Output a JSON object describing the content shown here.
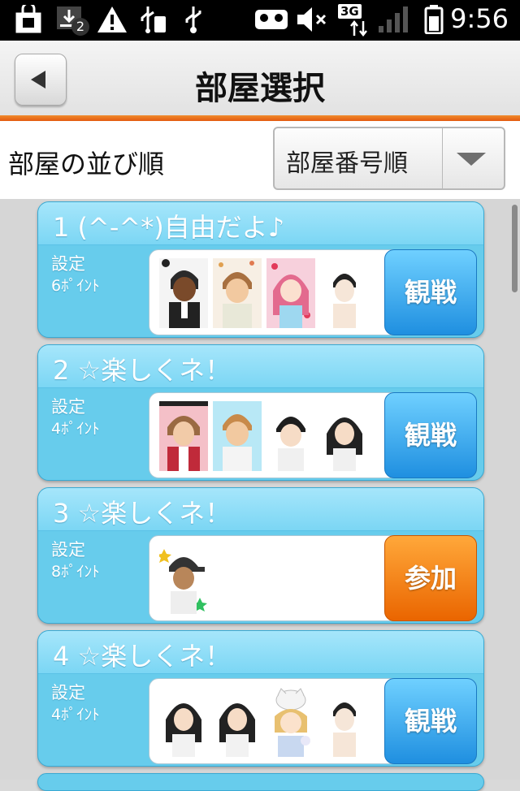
{
  "status_bar": {
    "notification_count": "2",
    "network": "3G",
    "time": "9:56"
  },
  "header": {
    "title": "部屋選択",
    "back_icon": "back-arrow-icon"
  },
  "sort": {
    "label": "部屋の並び順",
    "selected": "部屋番号順"
  },
  "rooms": [
    {
      "number": "1",
      "name": "(^-^*)自由だよ♪",
      "title": "1  (^-^*)自由だよ♪",
      "setting_label": "設定",
      "setting_value": "6ﾎﾟｲﾝﾄ",
      "action": "観戦",
      "action_type": "watch",
      "avatars": [
        "avatar-dark-suit",
        "avatar-brown-hair",
        "avatar-pink-hair",
        "avatar-blank-boy"
      ]
    },
    {
      "number": "2",
      "name": "☆楽しくネ！",
      "title": "2  ☆楽しくネ！",
      "setting_label": "設定",
      "setting_value": "4ﾎﾟｲﾝﾄ",
      "action": "観戦",
      "action_type": "watch",
      "avatars": [
        "avatar-brown-hair-red",
        "avatar-blond-boy",
        "avatar-black-hair-boy",
        "avatar-black-hair-girl"
      ]
    },
    {
      "number": "3",
      "name": "☆楽しくネ！",
      "title": "3  ☆楽しくネ！",
      "setting_label": "設定",
      "setting_value": "8ﾎﾟｲﾝﾄ",
      "action": "参加",
      "action_type": "join",
      "avatars": [
        "avatar-cap-boy"
      ]
    },
    {
      "number": "4",
      "name": "☆楽しくネ！",
      "title": "4  ☆楽しくネ！",
      "setting_label": "設定",
      "setting_value": "4ﾎﾟｲﾝﾄ",
      "action": "観戦",
      "action_type": "watch",
      "avatars": [
        "avatar-black-hair-girl",
        "avatar-black-hair-girl",
        "avatar-cat-hat-girl",
        "avatar-blank-boy"
      ]
    }
  ],
  "colors": {
    "header_accent": "#e8701a",
    "card": "#67ccec",
    "watch_button": "#2fa0ec",
    "join_button": "#f07a0e"
  }
}
